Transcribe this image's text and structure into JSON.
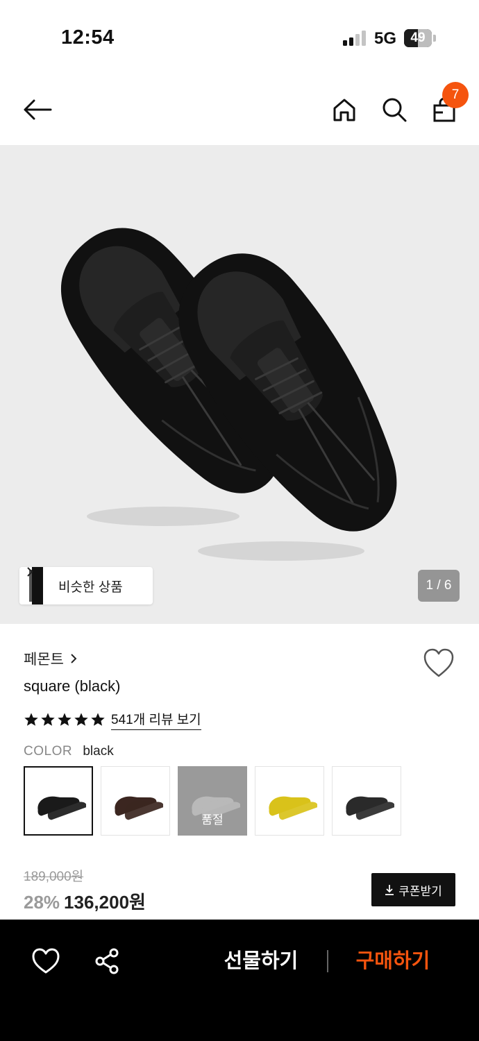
{
  "status_bar": {
    "time": "12:54",
    "network": "5G",
    "battery": "49",
    "battery_level": 0.49
  },
  "nav": {
    "cart_count": "7",
    "icons": [
      "back-arrow-icon",
      "home-icon",
      "search-icon",
      "shopping-bag-icon"
    ]
  },
  "gallery": {
    "similar_label": "비슷한 상품",
    "page_indicator": "1 / 6"
  },
  "product": {
    "brand": "페몬트",
    "name": "square (black)",
    "rating_stars": 5,
    "review_link": "541개 리뷰 보기",
    "color_label": "COLOR",
    "color_value": "black",
    "swatches": [
      {
        "color": "black",
        "shoe_color": "#1a1a1a",
        "selected": true,
        "soldout": false
      },
      {
        "color": "brown",
        "shoe_color": "#3b2620",
        "selected": false,
        "soldout": false
      },
      {
        "color": "grey",
        "shoe_color": "#b9b9b9",
        "selected": false,
        "soldout": true
      },
      {
        "color": "yellow",
        "shoe_color": "#d9c21a",
        "selected": false,
        "soldout": false
      },
      {
        "color": "black-white",
        "shoe_color": "#2a2a2a",
        "selected": false,
        "soldout": false
      }
    ],
    "soldout_label": "품절",
    "price_original": "189,000원",
    "discount": "28%",
    "price_final": "136,200원",
    "coupon_label": "쿠폰받기"
  },
  "bottom_bar": {
    "gift_label": "선물하기",
    "buy_label": "구매하기"
  },
  "colors": {
    "accent": "#f5540e",
    "hero_bg": "#ececec"
  }
}
